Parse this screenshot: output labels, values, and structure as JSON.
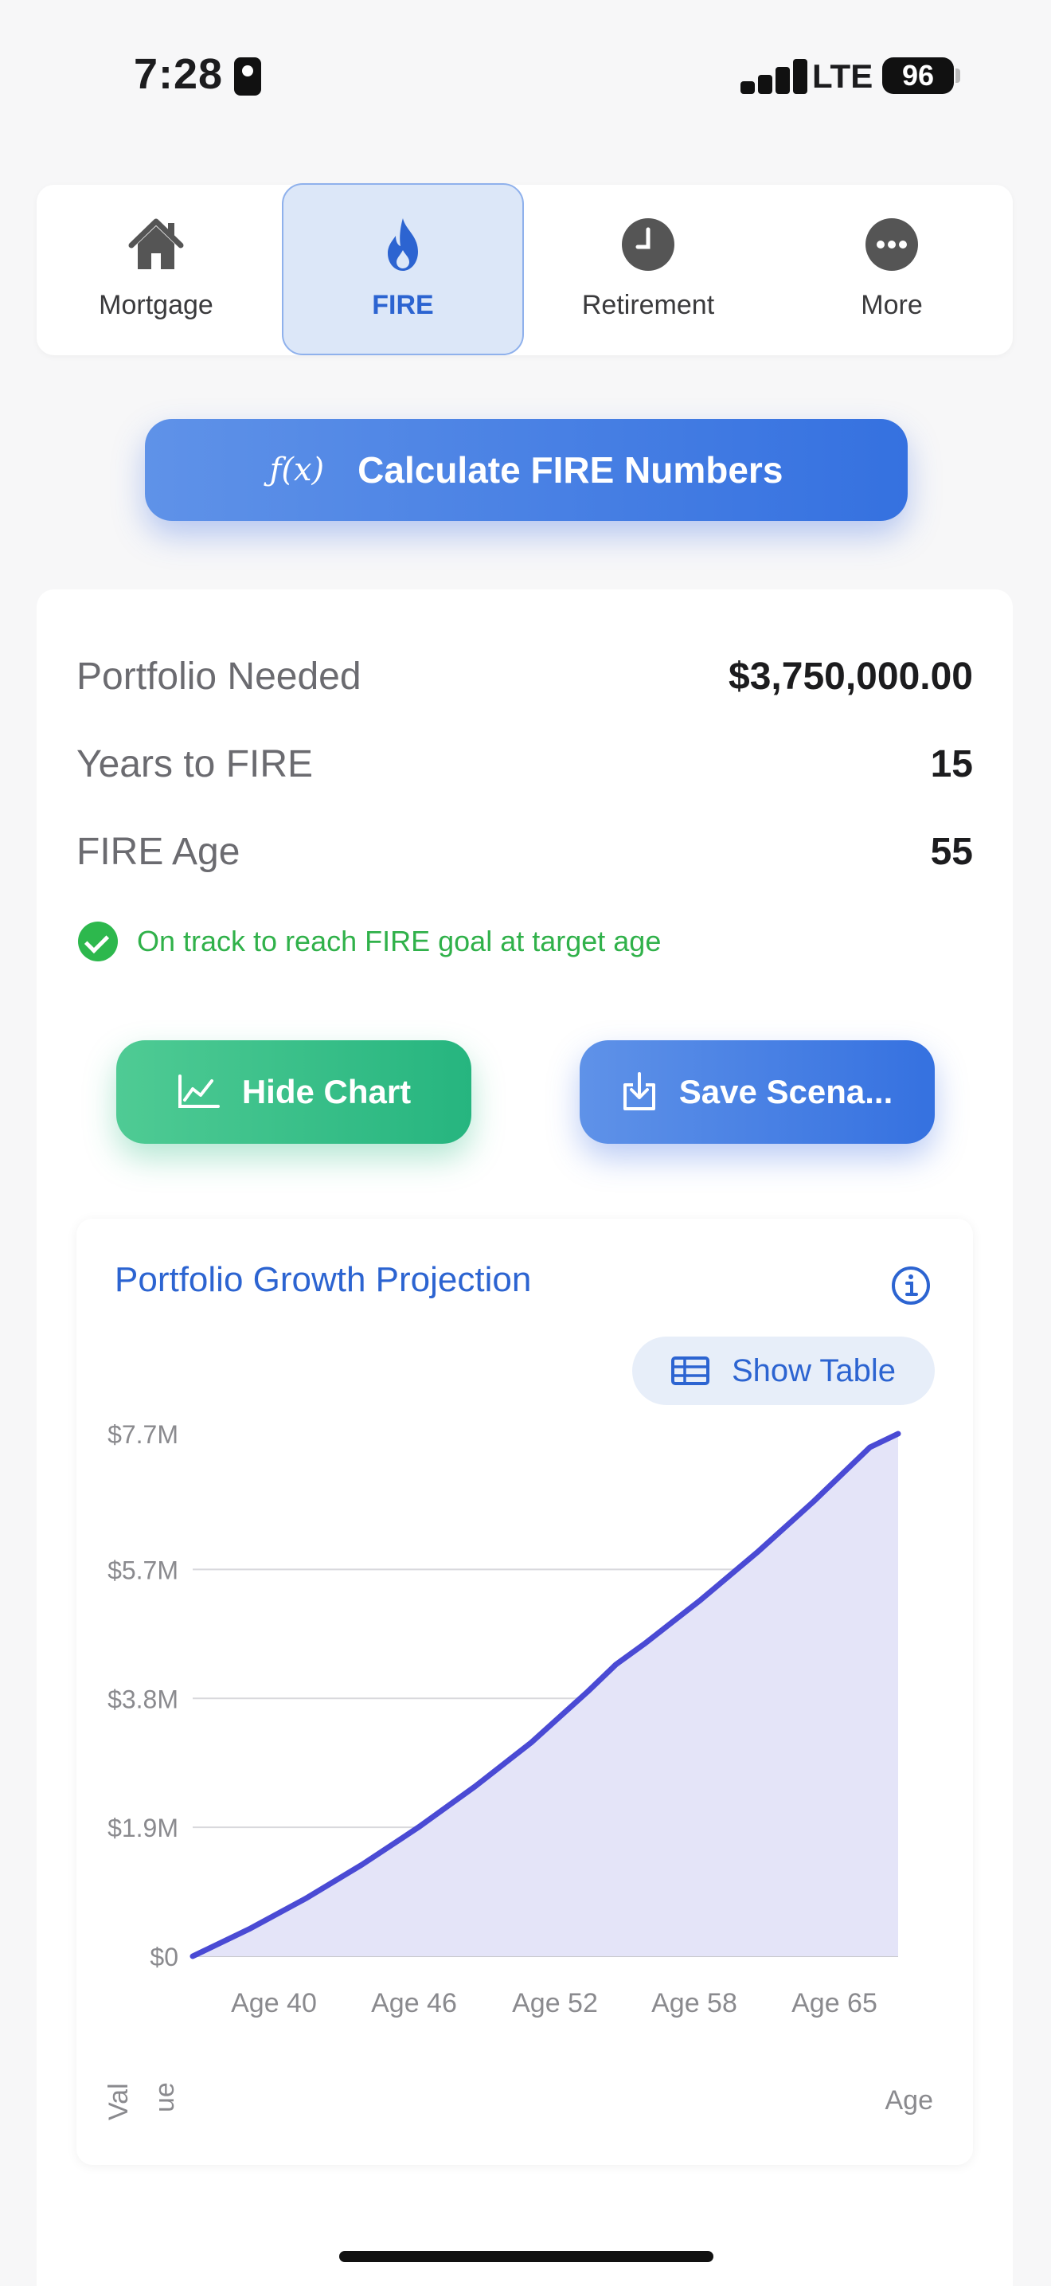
{
  "status_bar": {
    "time": "7:28",
    "network": "LTE",
    "battery": "96"
  },
  "tabs": [
    {
      "label": "Mortgage",
      "icon": "house-icon",
      "active": false
    },
    {
      "label": "FIRE",
      "icon": "flame-icon",
      "active": true
    },
    {
      "label": "Retirement",
      "icon": "clock-icon",
      "active": false
    },
    {
      "label": "More",
      "icon": "more-icon",
      "active": false
    }
  ],
  "calculate": {
    "icon_text": "ƒ(x)",
    "label": "Calculate FIRE Numbers"
  },
  "results": {
    "portfolio_needed": {
      "label": "Portfolio Needed",
      "value": "$3,750,000.00"
    },
    "years_to_fire": {
      "label": "Years to FIRE",
      "value": "15"
    },
    "fire_age": {
      "label": "FIRE Age",
      "value": "55"
    },
    "status": "On track to reach FIRE goal at target age"
  },
  "actions": {
    "hide_chart": "Hide Chart",
    "save_scenario": "Save Scena..."
  },
  "chart": {
    "title": "Portfolio Growth Projection",
    "show_table": "Show Table"
  },
  "chart_data": {
    "type": "area",
    "title": "Portfolio Growth Projection",
    "xlabel": "Age",
    "ylabel": "Val ue",
    "x_tick_labels": [
      "Age 40",
      "Age 46",
      "Age 52",
      "Age 58",
      "Age 65"
    ],
    "y_tick_labels": [
      "$0",
      "$1.9M",
      "$3.8M",
      "$5.7M",
      "$7.7M"
    ],
    "ylim": [
      0,
      7.7
    ],
    "y_unit": "$M",
    "x": [
      40,
      42,
      44,
      46,
      48,
      50,
      52,
      54,
      55,
      56,
      58,
      60,
      62,
      64,
      65
    ],
    "series": [
      {
        "values": [
          0,
          0.4,
          0.85,
          1.35,
          1.9,
          2.5,
          3.15,
          3.9,
          4.3,
          4.6,
          5.25,
          5.95,
          6.7,
          7.5,
          7.7
        ]
      }
    ],
    "line_color": "#4a4ad4",
    "fill_color": "#e4e4f8",
    "grid": true
  }
}
